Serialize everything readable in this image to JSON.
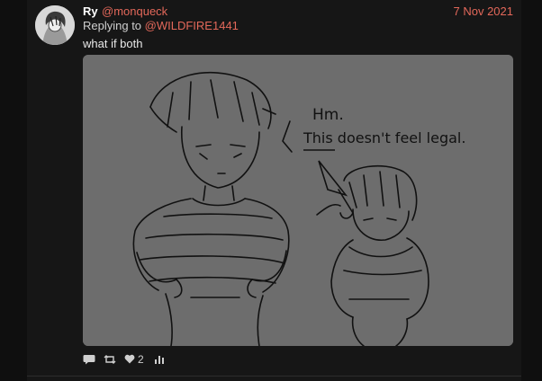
{
  "author": {
    "name": "Ry",
    "handle": "@monqueck",
    "avatar_icon": "avatar-portrait"
  },
  "date": "7 Nov 2021",
  "reply": {
    "prefix": "Replying to",
    "to": "@WILDFIRE1441"
  },
  "text": "what if both",
  "media": {
    "caption_line1": "Hm.",
    "caption_line2": "This doesn't feel legal."
  },
  "actions": {
    "reply_icon": "comment-icon",
    "retweet_icon": "retweet-icon",
    "like_icon": "heart-icon",
    "like_count": "2",
    "stats_icon": "bar-chart-icon"
  },
  "colors": {
    "link": "#e3685a",
    "background": "#161616",
    "media_background": "#6d6d6d"
  }
}
